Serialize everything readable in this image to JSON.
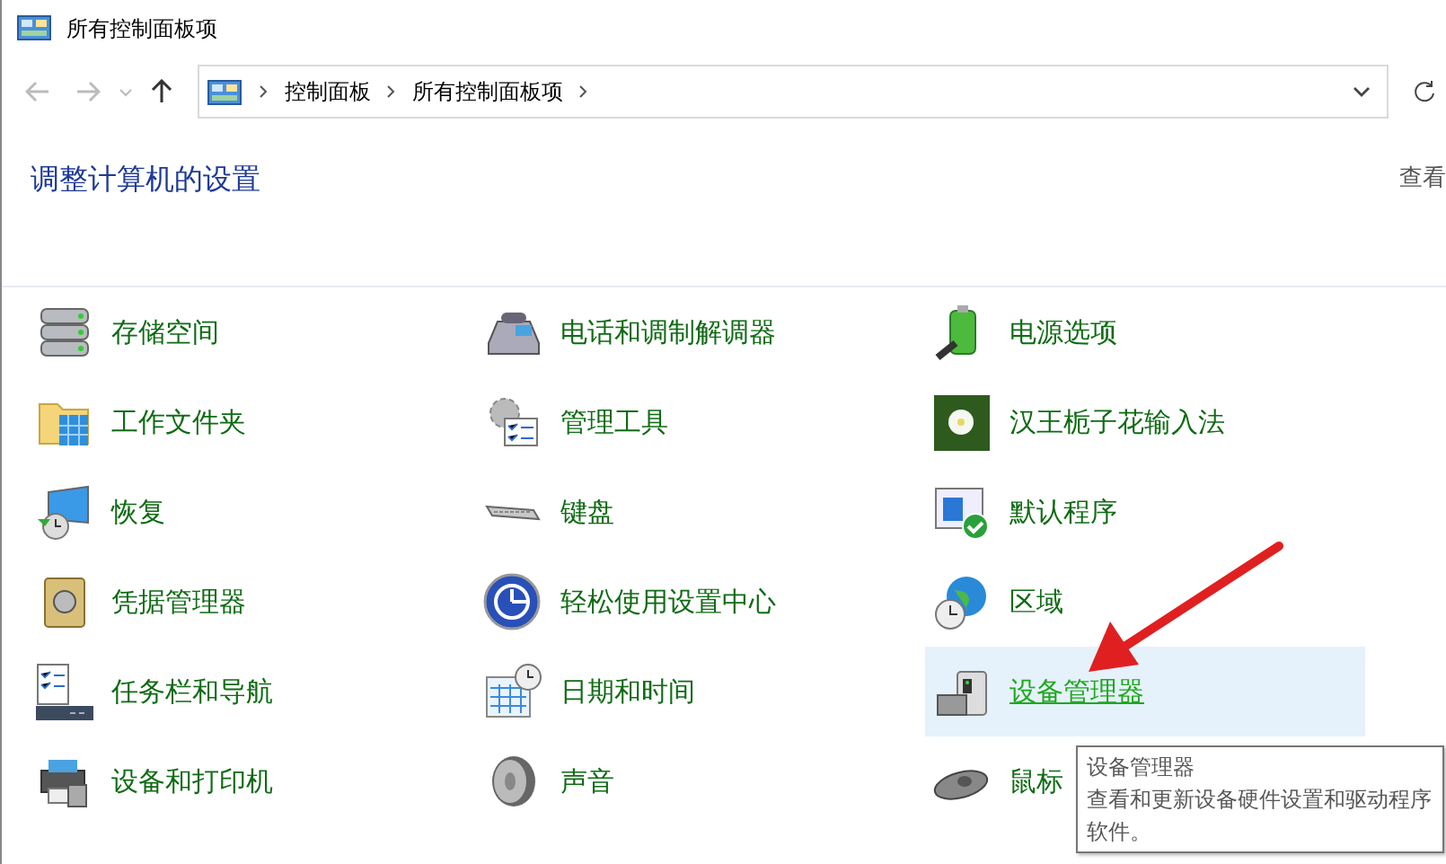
{
  "window": {
    "title": "所有控制面板项"
  },
  "navigation": {
    "back_enabled": false,
    "forward_enabled": false,
    "breadcrumbs": [
      "控制面板",
      "所有控制面板项"
    ]
  },
  "heading": "调整计算机的设置",
  "view_by_label": "查看",
  "items": [
    {
      "label": "存储空间",
      "selected": false
    },
    {
      "label": "电话和调制解调器",
      "selected": false
    },
    {
      "label": "电源选项",
      "selected": false
    },
    {
      "label": "工作文件夹",
      "selected": false
    },
    {
      "label": "管理工具",
      "selected": false
    },
    {
      "label": "汉王栀子花输入法",
      "selected": false
    },
    {
      "label": "恢复",
      "selected": false
    },
    {
      "label": "键盘",
      "selected": false
    },
    {
      "label": "默认程序",
      "selected": false
    },
    {
      "label": "凭据管理器",
      "selected": false
    },
    {
      "label": "轻松使用设置中心",
      "selected": false
    },
    {
      "label": "区域",
      "selected": false
    },
    {
      "label": "任务栏和导航",
      "selected": false
    },
    {
      "label": "日期和时间",
      "selected": false
    },
    {
      "label": "设备管理器",
      "selected": true
    },
    {
      "label": "设备和打印机",
      "selected": false
    },
    {
      "label": "声音",
      "selected": false
    },
    {
      "label": "鼠标",
      "selected": false
    }
  ],
  "tooltip": {
    "title": "设备管理器",
    "description": "查看和更新设备硬件设置和驱动程序软件。"
  }
}
